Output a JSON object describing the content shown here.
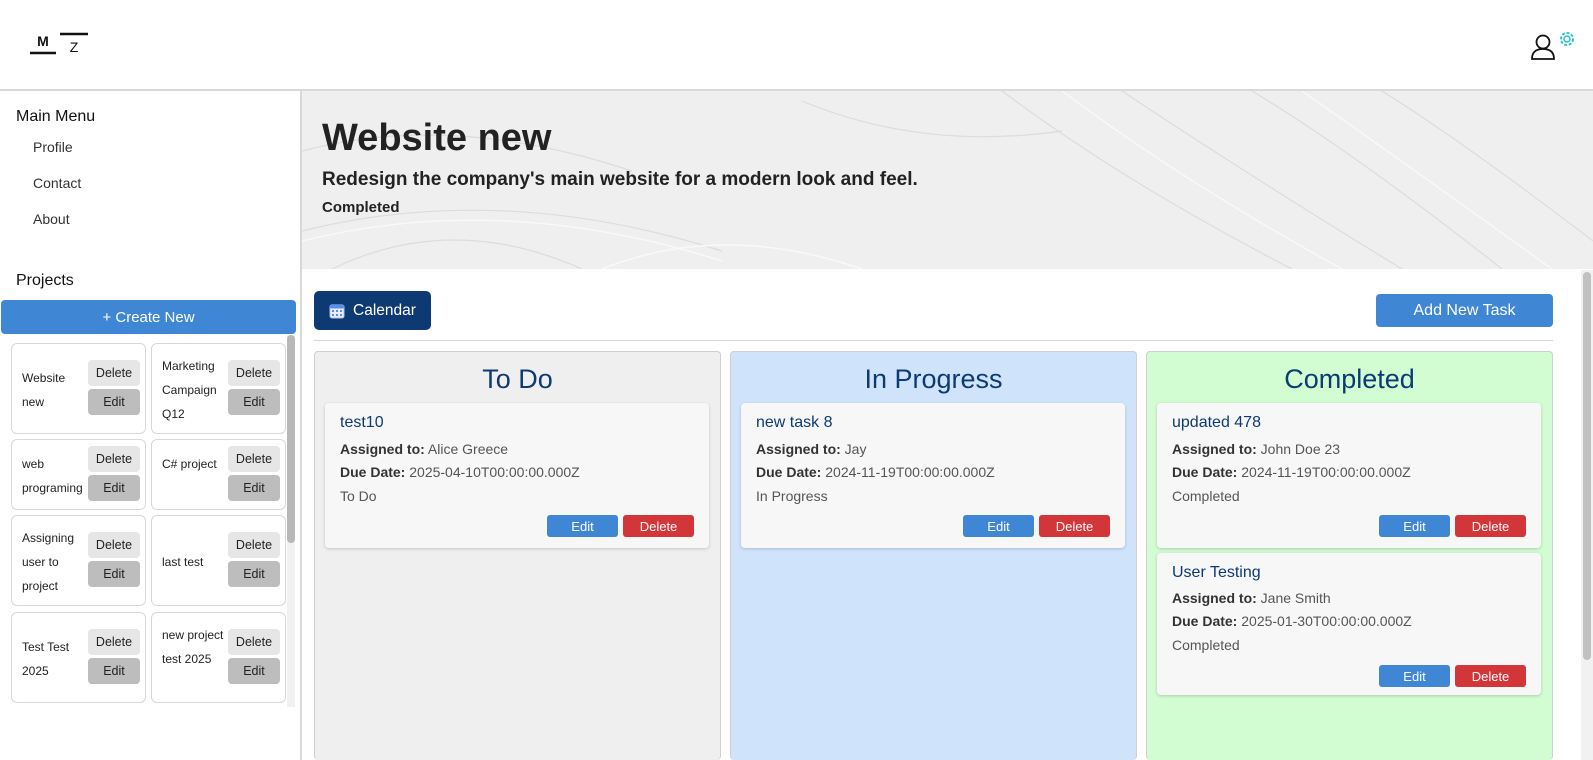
{
  "logo": {
    "letter_left": "M",
    "letter_right": "Z"
  },
  "header": {
    "user_icon": "user-icon",
    "settings_icon": "gear-icon",
    "accent_color": "#2ec4c4"
  },
  "sidebar": {
    "main_menu_title": "Main Menu",
    "menu_items": [
      {
        "label": "Profile"
      },
      {
        "label": "Contact"
      },
      {
        "label": "About"
      }
    ],
    "projects_title": "Projects",
    "create_new_label": "+ Create New",
    "projects": [
      {
        "name": "Website new",
        "delete_label": "Delete",
        "edit_label": "Edit"
      },
      {
        "name": "Marketing Campaign Q12",
        "delete_label": "Delete",
        "edit_label": "Edit"
      },
      {
        "name": "web programing",
        "delete_label": "Delete",
        "edit_label": "Edit"
      },
      {
        "name": "C# project",
        "delete_label": "Delete",
        "edit_label": "Edit"
      },
      {
        "name": "Assigning user to project",
        "delete_label": "Delete",
        "edit_label": "Edit"
      },
      {
        "name": "last test",
        "delete_label": "Delete",
        "edit_label": "Edit"
      },
      {
        "name": "Test Test 2025",
        "delete_label": "Delete",
        "edit_label": "Edit"
      },
      {
        "name": "new project test 2025",
        "delete_label": "Delete",
        "edit_label": "Edit"
      }
    ]
  },
  "project": {
    "title": "Website new",
    "description": "Redesign the company's main website for a modern look and feel.",
    "status": "Completed"
  },
  "toolbar": {
    "calendar_label": "Calendar",
    "calendar_icon": "calendar-icon",
    "add_task_label": "Add New Task"
  },
  "board": {
    "columns": [
      {
        "title": "To Do",
        "bg_color": "#efefef",
        "tasks": [
          {
            "title": "test10",
            "assigned_label": "Assigned to:",
            "assigned": "Alice Greece",
            "due_label": "Due Date:",
            "due": "2025-04-10T00:00:00.000Z",
            "status": "To Do",
            "edit_label": "Edit",
            "delete_label": "Delete"
          }
        ]
      },
      {
        "title": "In Progress",
        "bg_color": "#cfe4fb",
        "tasks": [
          {
            "title": "new task 8",
            "assigned_label": "Assigned to:",
            "assigned": "Jay",
            "due_label": "Due Date:",
            "due": "2024-11-19T00:00:00.000Z",
            "status": "In Progress",
            "edit_label": "Edit",
            "delete_label": "Delete"
          }
        ]
      },
      {
        "title": "Completed",
        "bg_color": "#d2fcd2",
        "tasks": [
          {
            "title": "updated 478",
            "assigned_label": "Assigned to:",
            "assigned": "John Doe 23",
            "due_label": "Due Date:",
            "due": "2024-11-19T00:00:00.000Z",
            "status": "Completed",
            "edit_label": "Edit",
            "delete_label": "Delete"
          },
          {
            "title": "User Testing",
            "assigned_label": "Assigned to:",
            "assigned": "Jane Smith",
            "due_label": "Due Date:",
            "due": "2025-01-30T00:00:00.000Z",
            "status": "Completed",
            "edit_label": "Edit",
            "delete_label": "Delete"
          }
        ]
      }
    ]
  }
}
